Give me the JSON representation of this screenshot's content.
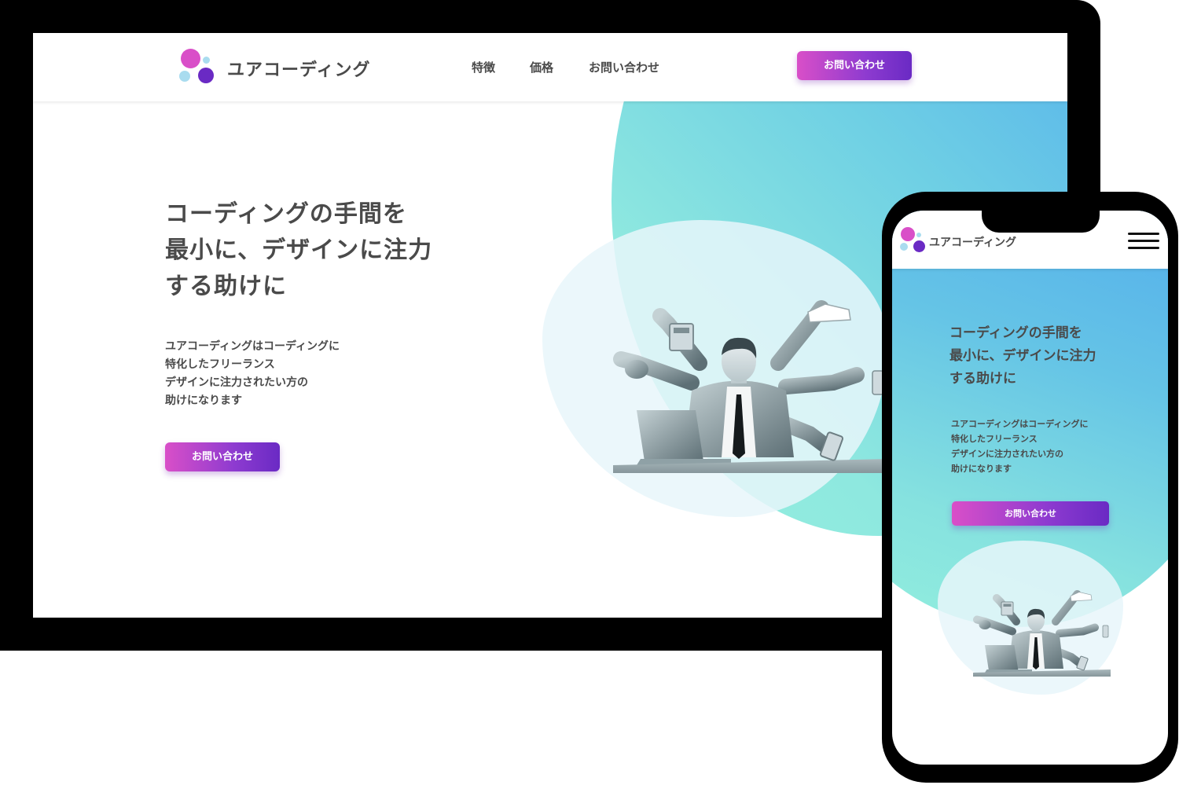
{
  "brand": {
    "name": "ユアコーディング",
    "colors": {
      "accent_pink": "#d94fc8",
      "accent_purple": "#6a2ac4",
      "gradient_blue": "#4aa3ef",
      "gradient_teal": "#94f0de",
      "text": "#4a4a4a"
    },
    "logo_icon": "circles-logo-icon"
  },
  "desktop": {
    "nav": [
      {
        "label": "特徴"
      },
      {
        "label": "価格"
      },
      {
        "label": "お問い合わせ"
      }
    ],
    "header_button": "お問い合わせ",
    "hero": {
      "title_lines": [
        "コーディングの手間を",
        "最小に、デザインに注力",
        "する助けに"
      ],
      "desc_lines": [
        "ユアコーディングはコーディングに",
        "特化したフリーランス",
        "デザインに注力されたい方の",
        "助けになります"
      ],
      "cta": "お問い合わせ",
      "illustration": "multitasking-businessman-illustration"
    }
  },
  "mobile": {
    "menu_icon": "hamburger-menu-icon",
    "hero": {
      "title_lines": [
        "コーディングの手間を",
        "最小に、デザインに注力",
        "する助けに"
      ],
      "desc_lines": [
        "ユアコーディングはコーディングに",
        "特化したフリーランス",
        "デザインに注力されたい方の",
        "助けになります"
      ],
      "cta": "お問い合わせ",
      "illustration": "multitasking-businessman-illustration"
    }
  }
}
